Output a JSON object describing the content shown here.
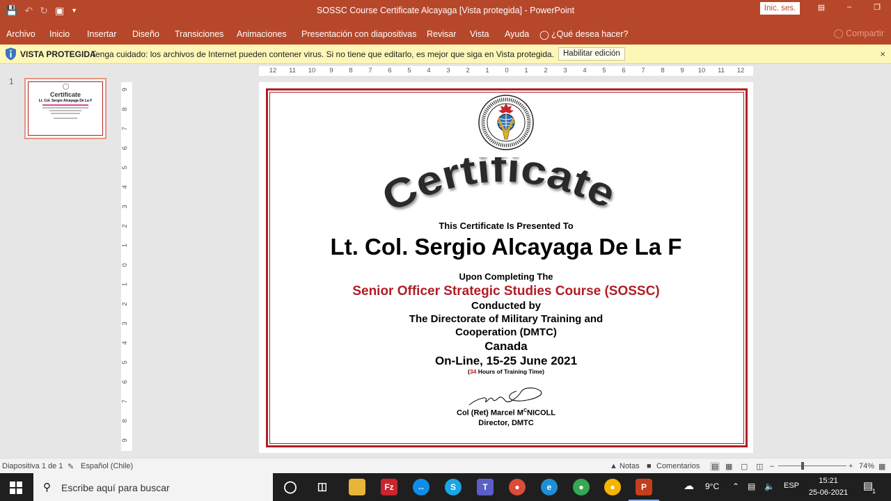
{
  "window": {
    "title": "SOSSC Course Certificate Alcayaga [Vista protegida]  -  PowerPoint",
    "signin": "Inic. ses."
  },
  "ribbon": {
    "tabs": [
      "Archivo",
      "Inicio",
      "Insertar",
      "Diseño",
      "Transiciones",
      "Animaciones",
      "Presentación con diapositivas",
      "Revisar",
      "Vista",
      "Ayuda"
    ],
    "tell_me": "¿Qué desea hacer?",
    "share": "Compartir"
  },
  "protected_view": {
    "label": "VISTA PROTEGIDA",
    "message": "Tenga cuidado: los archivos de Internet pueden contener virus. Si no tiene que editarlo, es mejor que siga en Vista protegida.",
    "button": "Habilitar edición"
  },
  "thumbnails": {
    "number": "1",
    "title": "Certificate",
    "name": "Lt. Col. Sergio Alcayaga De La F"
  },
  "rulers": {
    "horizontal": [
      "12",
      "11",
      "10",
      "9",
      "8",
      "7",
      "6",
      "5",
      "4",
      "3",
      "2",
      "1",
      "0",
      "1",
      "2",
      "3",
      "4",
      "5",
      "6",
      "7",
      "8",
      "9",
      "10",
      "11",
      "12"
    ],
    "vertical": [
      "9",
      "8",
      "7",
      "6",
      "5",
      "4",
      "3",
      "2",
      "1",
      "0",
      "1",
      "2",
      "3",
      "4",
      "5",
      "6",
      "7",
      "8",
      "9"
    ]
  },
  "slide": {
    "certificate_word": "Certificate",
    "presented_to": "This Certificate Is Presented To",
    "recipient": "Lt. Col. Sergio Alcayaga De La F",
    "upon": "Upon Completing The",
    "course": "Senior Officer Strategic Studies Course (SOSSC)",
    "conducted_by": "Conducted by",
    "directorate_1": "The Directorate of Military Training and",
    "directorate_2": "Cooperation (DMTC)",
    "country": "Canada",
    "dates": "On-Line, 15-25 June 2021",
    "hours_open": "(",
    "hours_num": "34",
    "hours_rest": " Hours of Training Time)",
    "signer_pre": "Col (Ret) Marcel M",
    "signer_sup": "C",
    "signer_post": "NICOLL",
    "signer_title": "Director, DMTC",
    "accent_color": "#b01e25"
  },
  "statusbar": {
    "slide_info": "Diapositiva 1 de 1",
    "language": "Español (Chile)",
    "notes": "Notas",
    "comments": "Comentarios",
    "zoom": "74%"
  },
  "taskbar": {
    "search_placeholder": "Escribe aquí para buscar",
    "weather": "9°C",
    "lang": "ESP",
    "time": "15:21",
    "date": "25-06-2021",
    "notification_count": "1"
  }
}
